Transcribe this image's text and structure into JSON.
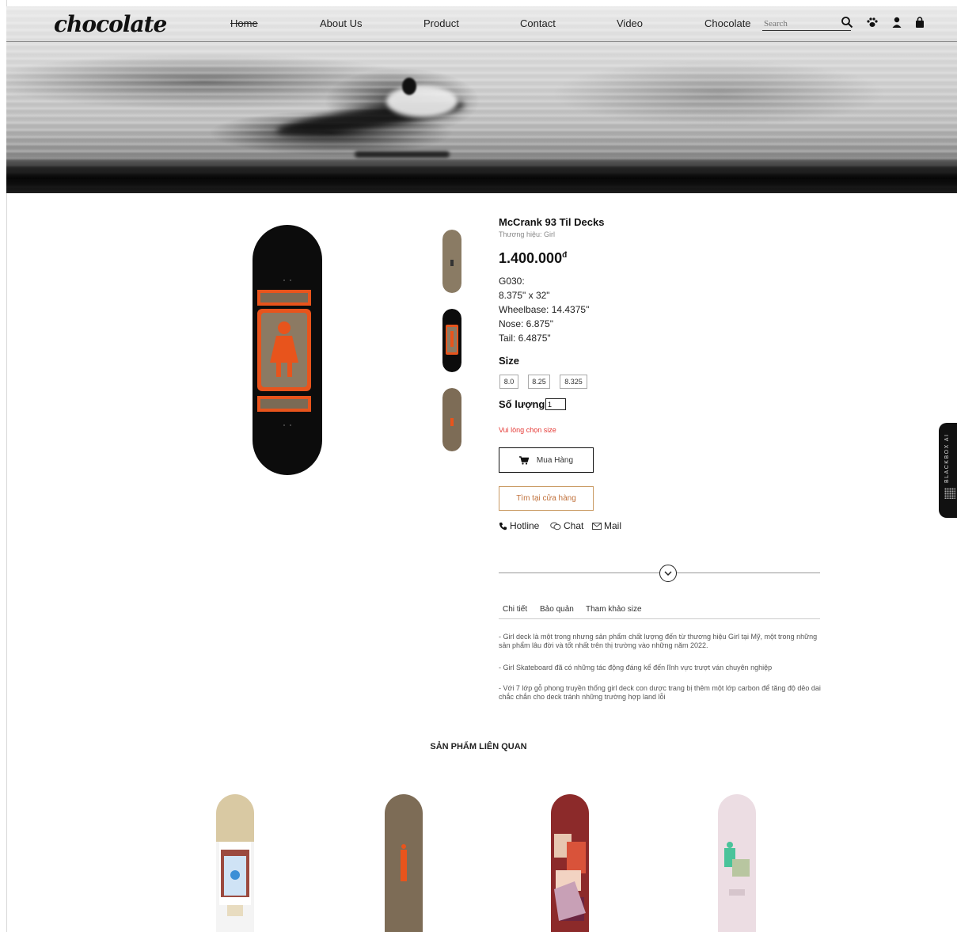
{
  "header": {
    "logo_text": "chocolate",
    "nav": [
      "Home",
      "About Us",
      "Product",
      "Contact",
      "Video",
      "Chocolate"
    ],
    "search_placeholder": "Search",
    "icons": [
      "search-icon",
      "paw-icon",
      "user-icon",
      "bag-icon"
    ]
  },
  "product": {
    "name": "McCrank 93 Til Decks",
    "brand": "Thương hiệu: Girl",
    "price": "1.400.000",
    "currency": "đ",
    "specs": [
      "G030:",
      "8.375\" x 32\"",
      "Wheelbase: 14.4375\"",
      "Nose: 6.875\"",
      "Tail: 6.4875\""
    ],
    "size_label": "Size",
    "sizes": [
      "8.0",
      "8.25",
      "8.325"
    ],
    "quantity_label": "Số lượng:",
    "quantity_value": "1",
    "size_warning": "Vui lòng chọn size",
    "buy_label": "Mua Hàng",
    "store_label": "Tìm tại cửa hàng",
    "contacts": [
      "Hotline",
      "Chat",
      "Mail"
    ]
  },
  "tabs": [
    "Chi tiết",
    "Bảo quản",
    "Tham khảo size"
  ],
  "description": [
    "- Girl deck là một trong nhưng sản phẩm chất lượng đến từ thương hiệu Girl tại Mỹ, một trong những sản phẩm lâu đời và tốt nhất trên thị trường vào những năm 2022.",
    "- Girl Skateboard đã có những tác động đáng kể đến lĩnh vực trượt ván chuyên nghiệp",
    "- Với 7 lớp gỗ phong truyền thống girl deck con dược trang bị thêm một lớp carbon để tăng độ dẻo dai chắc chắn cho deck tránh những trường hợp land lỗi"
  ],
  "related": {
    "title": "SẢN PHẨM LIÊN QUAN"
  },
  "widget": {
    "label": "BLACKBOX AI"
  },
  "colors": {
    "accent_orange": "#e8541c",
    "warning_red": "#e53935",
    "store_border": "#c99a63"
  }
}
